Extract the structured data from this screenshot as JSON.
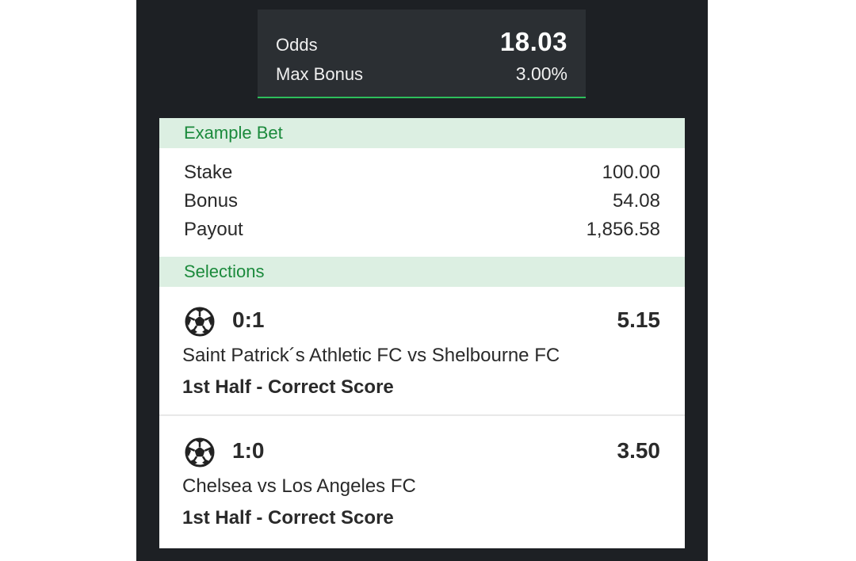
{
  "summary": {
    "odds_label": "Odds",
    "odds_value": "18.03",
    "max_bonus_label": "Max Bonus",
    "max_bonus_value": "3.00%"
  },
  "example_bet": {
    "header": "Example Bet",
    "rows": [
      {
        "label": "Stake",
        "value": "100.00"
      },
      {
        "label": "Bonus",
        "value": "54.08"
      },
      {
        "label": "Payout",
        "value": "1,856.58"
      }
    ]
  },
  "selections": {
    "header": "Selections",
    "items": [
      {
        "icon": "soccer-ball-icon",
        "score": "0:1",
        "odds": "5.15",
        "match": "Saint Patrick´s Athletic FC vs Shelbourne FC",
        "market": "1st Half - Correct Score"
      },
      {
        "icon": "soccer-ball-icon",
        "score": "1:0",
        "odds": "3.50",
        "match": "Chelsea vs Los Angeles FC",
        "market": "1st Half - Correct Score"
      }
    ]
  },
  "colors": {
    "background_dark": "#1d2024",
    "summary_panel": "#2b2f33",
    "accent_green": "#2dbe5b",
    "header_bg": "#dcefe2",
    "header_text": "#1b8a3c"
  }
}
